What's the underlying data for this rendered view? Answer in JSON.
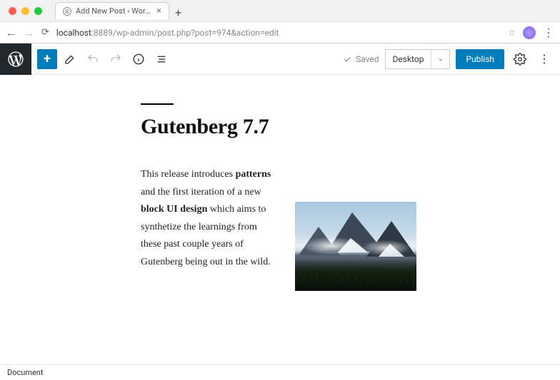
{
  "browser": {
    "tab_title": "Add New Post ‹ WordPress D…",
    "url_host": "localhost",
    "url_port_path": ":8889/wp-admin/post.php?post=974&action=edit"
  },
  "topbar": {
    "saved_label": "Saved",
    "view_label": "Desktop",
    "publish_label": "Publish"
  },
  "post": {
    "title": "Gutenberg 7.7",
    "body_html": "This release introduces <b>patterns</b> and the first iteration of a new <b>block UI design</b> which aims to synthetize the learnings from these past couple years of Gutenberg being out in the wild."
  },
  "footer": {
    "breadcrumb": "Document"
  }
}
